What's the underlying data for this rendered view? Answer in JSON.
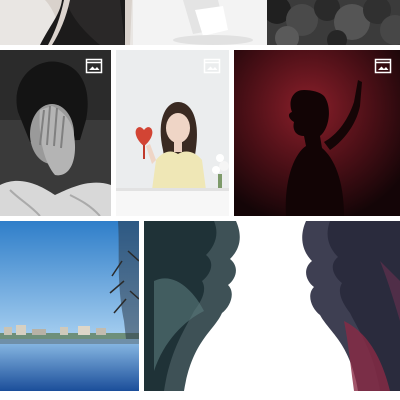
{
  "colors": {
    "background": "#ffffff",
    "badge": "#ffffff"
  },
  "icons": {
    "multi_image_badge": "gallery-stack-icon"
  },
  "tiles": [
    {
      "name": "photo-tile-woman-black-top",
      "has_badge": false
    },
    {
      "name": "photo-tile-white-product",
      "has_badge": false
    },
    {
      "name": "photo-tile-dark-forest",
      "has_badge": false
    },
    {
      "name": "photo-tile-bw-portrait-hand-eye",
      "has_badge": true
    },
    {
      "name": "photo-tile-woman-red-heart",
      "has_badge": true
    },
    {
      "name": "photo-tile-red-silhouette",
      "has_badge": true
    },
    {
      "name": "photo-tile-lake-skyline",
      "has_badge": false
    },
    {
      "name": "photo-tile-smoke-faces",
      "has_badge": false
    }
  ]
}
